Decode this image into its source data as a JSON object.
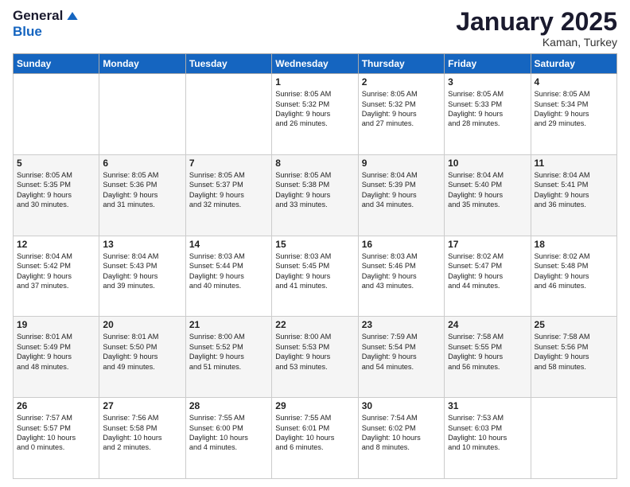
{
  "header": {
    "logo_line1": "General",
    "logo_line2": "Blue",
    "month": "January 2025",
    "location": "Kaman, Turkey"
  },
  "days_of_week": [
    "Sunday",
    "Monday",
    "Tuesday",
    "Wednesday",
    "Thursday",
    "Friday",
    "Saturday"
  ],
  "weeks": [
    [
      {
        "day": "",
        "info": ""
      },
      {
        "day": "",
        "info": ""
      },
      {
        "day": "",
        "info": ""
      },
      {
        "day": "1",
        "info": "Sunrise: 8:05 AM\nSunset: 5:32 PM\nDaylight: 9 hours\nand 26 minutes."
      },
      {
        "day": "2",
        "info": "Sunrise: 8:05 AM\nSunset: 5:32 PM\nDaylight: 9 hours\nand 27 minutes."
      },
      {
        "day": "3",
        "info": "Sunrise: 8:05 AM\nSunset: 5:33 PM\nDaylight: 9 hours\nand 28 minutes."
      },
      {
        "day": "4",
        "info": "Sunrise: 8:05 AM\nSunset: 5:34 PM\nDaylight: 9 hours\nand 29 minutes."
      }
    ],
    [
      {
        "day": "5",
        "info": "Sunrise: 8:05 AM\nSunset: 5:35 PM\nDaylight: 9 hours\nand 30 minutes."
      },
      {
        "day": "6",
        "info": "Sunrise: 8:05 AM\nSunset: 5:36 PM\nDaylight: 9 hours\nand 31 minutes."
      },
      {
        "day": "7",
        "info": "Sunrise: 8:05 AM\nSunset: 5:37 PM\nDaylight: 9 hours\nand 32 minutes."
      },
      {
        "day": "8",
        "info": "Sunrise: 8:05 AM\nSunset: 5:38 PM\nDaylight: 9 hours\nand 33 minutes."
      },
      {
        "day": "9",
        "info": "Sunrise: 8:04 AM\nSunset: 5:39 PM\nDaylight: 9 hours\nand 34 minutes."
      },
      {
        "day": "10",
        "info": "Sunrise: 8:04 AM\nSunset: 5:40 PM\nDaylight: 9 hours\nand 35 minutes."
      },
      {
        "day": "11",
        "info": "Sunrise: 8:04 AM\nSunset: 5:41 PM\nDaylight: 9 hours\nand 36 minutes."
      }
    ],
    [
      {
        "day": "12",
        "info": "Sunrise: 8:04 AM\nSunset: 5:42 PM\nDaylight: 9 hours\nand 37 minutes."
      },
      {
        "day": "13",
        "info": "Sunrise: 8:04 AM\nSunset: 5:43 PM\nDaylight: 9 hours\nand 39 minutes."
      },
      {
        "day": "14",
        "info": "Sunrise: 8:03 AM\nSunset: 5:44 PM\nDaylight: 9 hours\nand 40 minutes."
      },
      {
        "day": "15",
        "info": "Sunrise: 8:03 AM\nSunset: 5:45 PM\nDaylight: 9 hours\nand 41 minutes."
      },
      {
        "day": "16",
        "info": "Sunrise: 8:03 AM\nSunset: 5:46 PM\nDaylight: 9 hours\nand 43 minutes."
      },
      {
        "day": "17",
        "info": "Sunrise: 8:02 AM\nSunset: 5:47 PM\nDaylight: 9 hours\nand 44 minutes."
      },
      {
        "day": "18",
        "info": "Sunrise: 8:02 AM\nSunset: 5:48 PM\nDaylight: 9 hours\nand 46 minutes."
      }
    ],
    [
      {
        "day": "19",
        "info": "Sunrise: 8:01 AM\nSunset: 5:49 PM\nDaylight: 9 hours\nand 48 minutes."
      },
      {
        "day": "20",
        "info": "Sunrise: 8:01 AM\nSunset: 5:50 PM\nDaylight: 9 hours\nand 49 minutes."
      },
      {
        "day": "21",
        "info": "Sunrise: 8:00 AM\nSunset: 5:52 PM\nDaylight: 9 hours\nand 51 minutes."
      },
      {
        "day": "22",
        "info": "Sunrise: 8:00 AM\nSunset: 5:53 PM\nDaylight: 9 hours\nand 53 minutes."
      },
      {
        "day": "23",
        "info": "Sunrise: 7:59 AM\nSunset: 5:54 PM\nDaylight: 9 hours\nand 54 minutes."
      },
      {
        "day": "24",
        "info": "Sunrise: 7:58 AM\nSunset: 5:55 PM\nDaylight: 9 hours\nand 56 minutes."
      },
      {
        "day": "25",
        "info": "Sunrise: 7:58 AM\nSunset: 5:56 PM\nDaylight: 9 hours\nand 58 minutes."
      }
    ],
    [
      {
        "day": "26",
        "info": "Sunrise: 7:57 AM\nSunset: 5:57 PM\nDaylight: 10 hours\nand 0 minutes."
      },
      {
        "day": "27",
        "info": "Sunrise: 7:56 AM\nSunset: 5:58 PM\nDaylight: 10 hours\nand 2 minutes."
      },
      {
        "day": "28",
        "info": "Sunrise: 7:55 AM\nSunset: 6:00 PM\nDaylight: 10 hours\nand 4 minutes."
      },
      {
        "day": "29",
        "info": "Sunrise: 7:55 AM\nSunset: 6:01 PM\nDaylight: 10 hours\nand 6 minutes."
      },
      {
        "day": "30",
        "info": "Sunrise: 7:54 AM\nSunset: 6:02 PM\nDaylight: 10 hours\nand 8 minutes."
      },
      {
        "day": "31",
        "info": "Sunrise: 7:53 AM\nSunset: 6:03 PM\nDaylight: 10 hours\nand 10 minutes."
      },
      {
        "day": "",
        "info": ""
      }
    ]
  ]
}
